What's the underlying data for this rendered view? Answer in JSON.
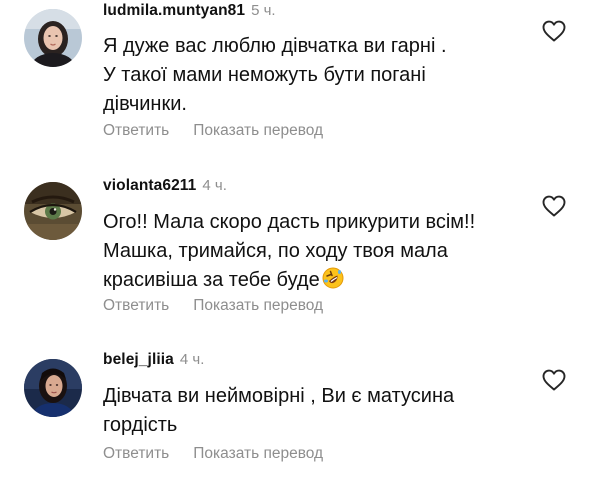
{
  "comments": [
    {
      "username": "ludmila.muntyan81",
      "time": "5 ч.",
      "lines": [
        "Я дуже вас люблю дівчатка ви гарні .",
        "У такої мами неможуть бути погані",
        "дівчинки."
      ],
      "reply_label": "Ответить",
      "translate_label": "Показать перевод",
      "like_icon": "heart-outline-icon"
    },
    {
      "username": "violanta6211",
      "time": "4 ч.",
      "lines": [
        "Ого!! Мала скоро дасть прикурити всім!!",
        "Машка, тримайся, по ходу твоя мала",
        "красивіша за тебе  буде"
      ],
      "emoji": "rolling-on-floor-laughing-emoji",
      "reply_label": "Ответить",
      "translate_label": "Показать перевод",
      "like_icon": "heart-outline-icon"
    },
    {
      "username": "belej_jliia",
      "time": "4 ч.",
      "lines": [
        "Дівчата ви неймовірні , Ви є матусина",
        "гордість"
      ],
      "reply_label": "Ответить",
      "translate_label": "Показать перевод",
      "like_icon": "heart-outline-icon"
    }
  ],
  "colors": {
    "text": "#111111",
    "secondary": "#8e8e8e",
    "background": "#ffffff"
  }
}
